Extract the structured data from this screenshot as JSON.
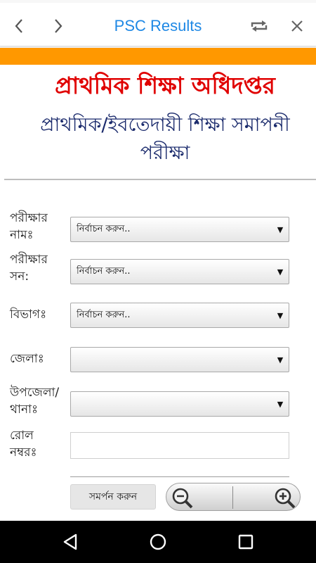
{
  "app_bar": {
    "title": "PSC Results",
    "icons": [
      "back-icon",
      "forward-icon",
      "refresh-icon",
      "close-icon"
    ]
  },
  "header": {
    "organization": "প্রাথমিক শিক্ষা অধিদপ্তর",
    "exam_title": "প্রাথমিক/ইবতেদায়ী শিক্ষা সমাপনী পরীক্ষা"
  },
  "form": {
    "exam_name_label": "পরীক্ষার নামঃ",
    "exam_name_value": "নির্বাচন করুন..",
    "exam_year_label": "পরীক্ষার সন:",
    "exam_year_value": "নির্বাচন করুন..",
    "division_label": "বিভাগঃ",
    "division_value": "নির্বাচন করুন..",
    "district_label": "জেলাঃ",
    "district_value": "",
    "upazila_label": "উপজেলা/ থানাঃ",
    "upazila_value": "",
    "roll_label": "রোল নম্বরঃ",
    "roll_value": "",
    "submit_label": "সমর্পন করুন",
    "dropdown_arrow": "▼"
  },
  "colors": {
    "accent_orange": "#ff9800",
    "title_blue": "#1e88e5",
    "heading_red": "#e00000",
    "heading_navy": "#1a2a6c"
  },
  "system_nav": [
    "back-triangle-icon",
    "home-circle-icon",
    "recents-square-icon"
  ]
}
